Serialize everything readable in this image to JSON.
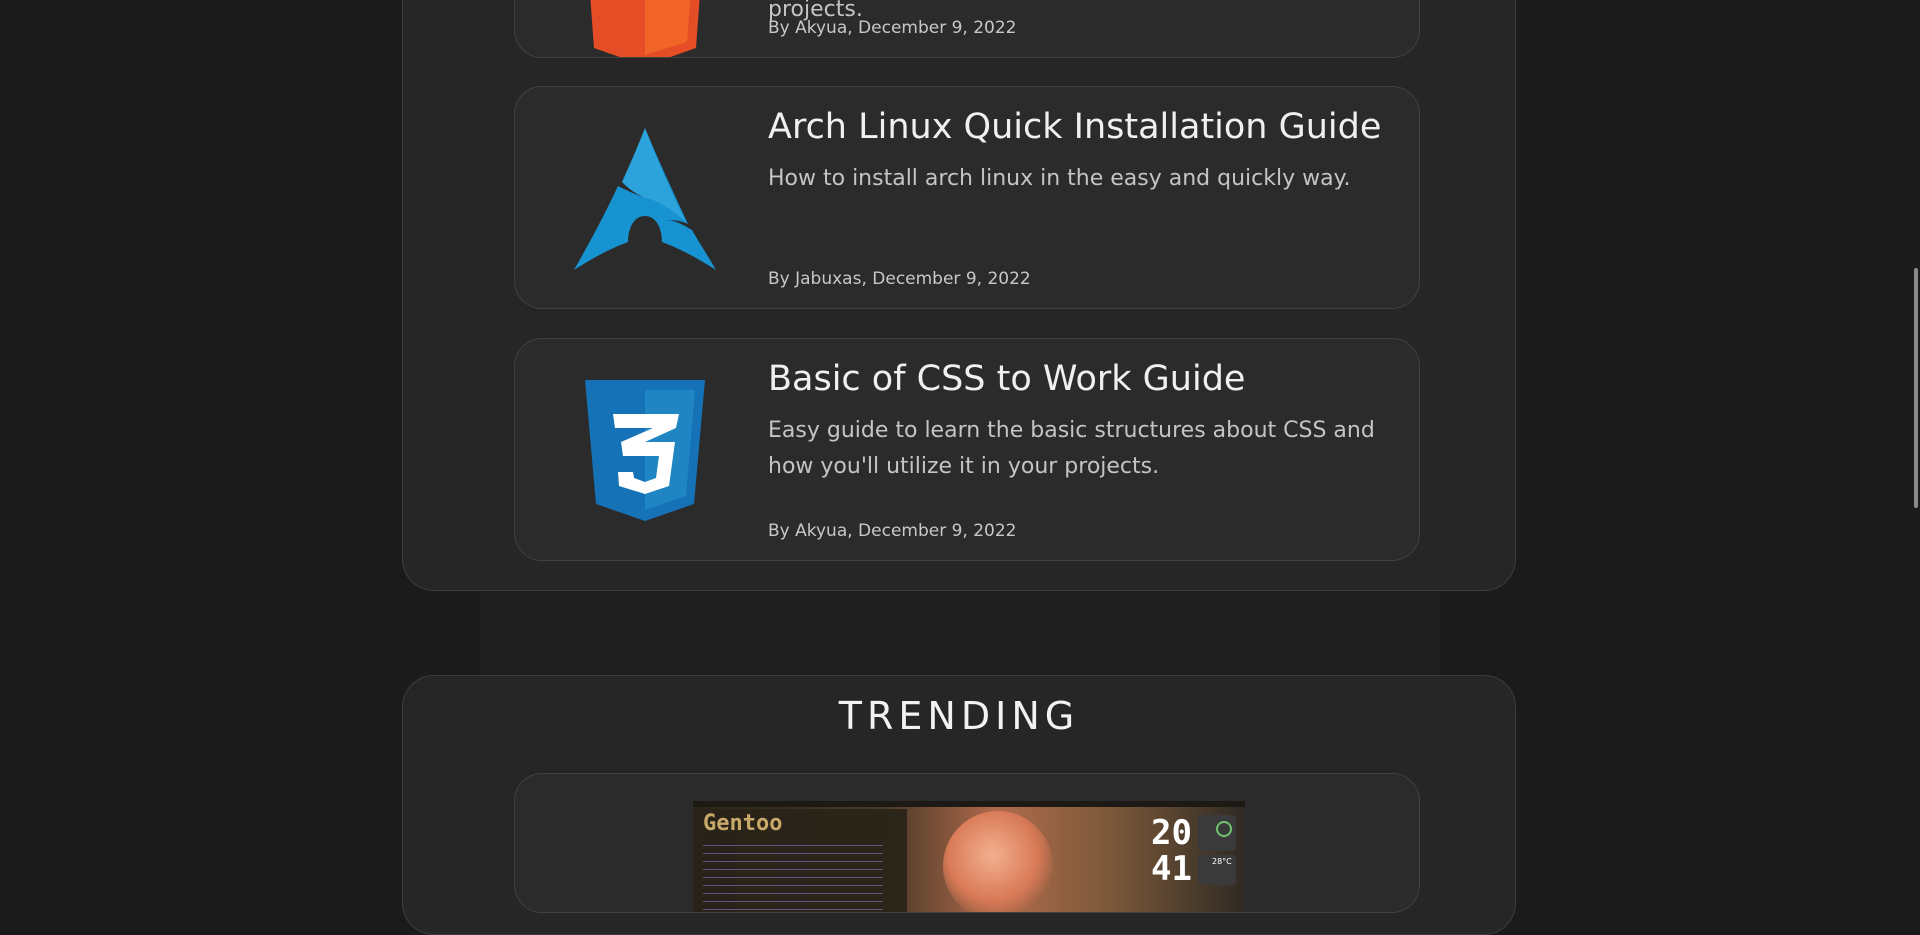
{
  "posts": [
    {
      "title": "",
      "description": "projects.",
      "meta": "By Akyua, December 9, 2022",
      "icon": "html5-icon"
    },
    {
      "title": "Arch Linux Quick Installation Guide",
      "description": "How to install arch linux in the easy and quickly way.",
      "meta": "By Jabuxas, December 9, 2022",
      "icon": "arch-linux-icon"
    },
    {
      "title": "Basic of CSS to Work Guide",
      "description": "Easy guide to learn the basic structures about CSS and how you'll utilize it in your projects.",
      "meta": "By Akyua, December 9, 2022",
      "icon": "css3-icon"
    }
  ],
  "trending": {
    "heading": "TRENDING",
    "preview": {
      "logo_text": "Gentoo",
      "clock_hours": "20",
      "clock_minutes": "41",
      "temperature": "28°C"
    }
  },
  "colors": {
    "background": "#1b1b1b",
    "panel": "#262626",
    "card": "#2b2b2b",
    "arch_blue": "#1793d1",
    "css_blue": "#1572b6",
    "html_orange": "#e44d26"
  }
}
